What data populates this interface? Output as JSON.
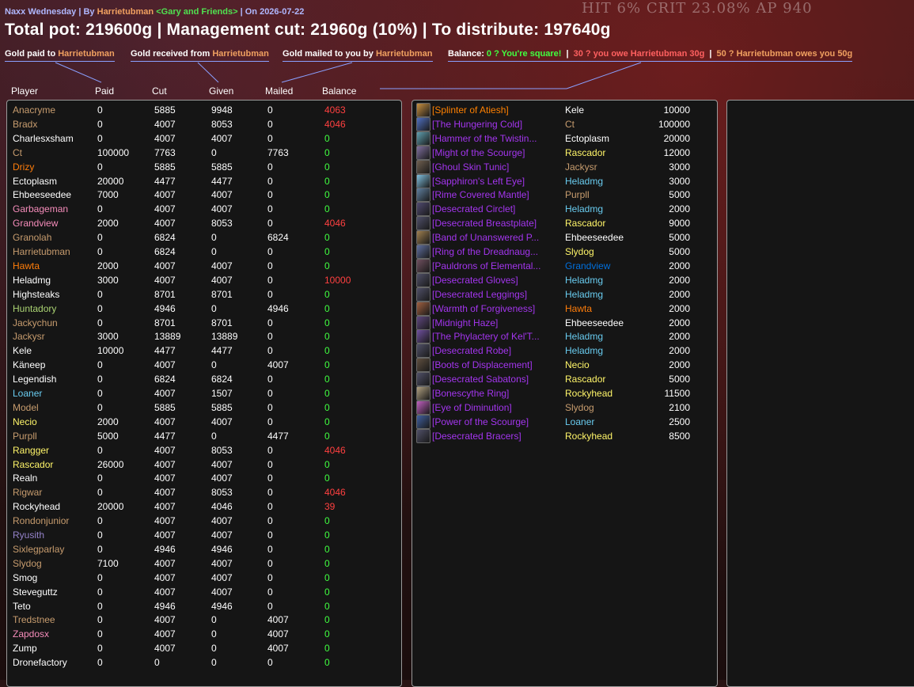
{
  "header": {
    "raid_name": "Naxx Wednesday",
    "by_prefix": "| By",
    "author": "Harrietubman",
    "guild": "<Gary and Friends>",
    "date_text": "| On 2026-07-22"
  },
  "title": "Total pot: 219600g | Management cut: 21960g (10%) | To distribute: 197640g",
  "background_text": "HIT 6% CRIT 23.08% AP 940",
  "legend": {
    "paid_prefix": "Gold paid to",
    "received_prefix": "Gold received from",
    "mailed_prefix": "Gold mailed to you by",
    "name": "Harrietubman",
    "balance_label": "Balance:",
    "square": "0 ? You're square!",
    "you_owe": "30 ? you owe Harrietubman 30g",
    "owes_you": "50 ? Harrietubman owes you 50g"
  },
  "columns": {
    "player": "Player",
    "paid": "Paid",
    "cut": "Cut",
    "given": "Given",
    "mailed": "Mailed",
    "balance": "Balance"
  },
  "colors": {
    "druid": "#ff7d0a",
    "paladin": "#f58cba",
    "warrior": "#c79c6e",
    "mage": "#69ccf0",
    "rogue": "#fff569",
    "warlock": "#9482c9",
    "hunter": "#abd473",
    "priest": "#ffffff",
    "shaman": "#0070de",
    "epic": "#a335ee",
    "legendary": "#ff8000",
    "balance_zero": "#40ff40",
    "balance_owe": "#ff4040"
  },
  "players": [
    {
      "name": "Anacryme",
      "cls": "warrior",
      "paid": "0",
      "cut": "5885",
      "given": "9948",
      "mailed": "0",
      "balance": "4063"
    },
    {
      "name": "Bradx",
      "cls": "warrior",
      "paid": "0",
      "cut": "4007",
      "given": "8053",
      "mailed": "0",
      "balance": "4046"
    },
    {
      "name": "Charlesxsham",
      "cls": "priest",
      "paid": "0",
      "cut": "4007",
      "given": "4007",
      "mailed": "0",
      "balance": "0"
    },
    {
      "name": "Ct",
      "cls": "warrior",
      "paid": "100000",
      "cut": "7763",
      "given": "0",
      "mailed": "7763",
      "balance": "0"
    },
    {
      "name": "Drizy",
      "cls": "druid",
      "paid": "0",
      "cut": "5885",
      "given": "5885",
      "mailed": "0",
      "balance": "0"
    },
    {
      "name": "Ectoplasm",
      "cls": "priest",
      "paid": "20000",
      "cut": "4477",
      "given": "4477",
      "mailed": "0",
      "balance": "0"
    },
    {
      "name": "Ehbeeseedee",
      "cls": "priest",
      "paid": "7000",
      "cut": "4007",
      "given": "4007",
      "mailed": "0",
      "balance": "0"
    },
    {
      "name": "Garbageman",
      "cls": "paladin",
      "paid": "0",
      "cut": "4007",
      "given": "4007",
      "mailed": "0",
      "balance": "0"
    },
    {
      "name": "Grandview",
      "cls": "paladin",
      "paid": "2000",
      "cut": "4007",
      "given": "8053",
      "mailed": "0",
      "balance": "4046"
    },
    {
      "name": "Granolah",
      "cls": "warrior",
      "paid": "0",
      "cut": "6824",
      "given": "0",
      "mailed": "6824",
      "balance": "0"
    },
    {
      "name": "Harrietubman",
      "cls": "warrior",
      "paid": "0",
      "cut": "6824",
      "given": "0",
      "mailed": "0",
      "balance": "0"
    },
    {
      "name": "Hawta",
      "cls": "druid",
      "paid": "2000",
      "cut": "4007",
      "given": "4007",
      "mailed": "0",
      "balance": "0"
    },
    {
      "name": "Heladmg",
      "cls": "priest",
      "paid": "3000",
      "cut": "4007",
      "given": "4007",
      "mailed": "0",
      "balance": "10000"
    },
    {
      "name": "Highsteaks",
      "cls": "priest",
      "paid": "0",
      "cut": "8701",
      "given": "8701",
      "mailed": "0",
      "balance": "0"
    },
    {
      "name": "Huntadory",
      "cls": "hunter",
      "paid": "0",
      "cut": "4946",
      "given": "0",
      "mailed": "4946",
      "balance": "0"
    },
    {
      "name": "Jackychun",
      "cls": "warrior",
      "paid": "0",
      "cut": "8701",
      "given": "8701",
      "mailed": "0",
      "balance": "0"
    },
    {
      "name": "Jackysr",
      "cls": "warrior",
      "paid": "3000",
      "cut": "13889",
      "given": "13889",
      "mailed": "0",
      "balance": "0"
    },
    {
      "name": "Kele",
      "cls": "priest",
      "paid": "10000",
      "cut": "4477",
      "given": "4477",
      "mailed": "0",
      "balance": "0"
    },
    {
      "name": "Käneep",
      "cls": "priest",
      "paid": "0",
      "cut": "4007",
      "given": "0",
      "mailed": "4007",
      "balance": "0"
    },
    {
      "name": "Legendish",
      "cls": "priest",
      "paid": "0",
      "cut": "6824",
      "given": "6824",
      "mailed": "0",
      "balance": "0"
    },
    {
      "name": "Loaner",
      "cls": "mage",
      "paid": "0",
      "cut": "4007",
      "given": "1507",
      "mailed": "0",
      "balance": "0"
    },
    {
      "name": "Model",
      "cls": "warrior",
      "paid": "0",
      "cut": "5885",
      "given": "5885",
      "mailed": "0",
      "balance": "0"
    },
    {
      "name": "Necio",
      "cls": "rogue",
      "paid": "2000",
      "cut": "4007",
      "given": "4007",
      "mailed": "0",
      "balance": "0"
    },
    {
      "name": "Purpll",
      "cls": "warrior",
      "paid": "5000",
      "cut": "4477",
      "given": "0",
      "mailed": "4477",
      "balance": "0"
    },
    {
      "name": "Rangger",
      "cls": "rogue",
      "paid": "0",
      "cut": "4007",
      "given": "8053",
      "mailed": "0",
      "balance": "4046"
    },
    {
      "name": "Rascador",
      "cls": "rogue",
      "paid": "26000",
      "cut": "4007",
      "given": "4007",
      "mailed": "0",
      "balance": "0"
    },
    {
      "name": "Realn",
      "cls": "priest",
      "paid": "0",
      "cut": "4007",
      "given": "4007",
      "mailed": "0",
      "balance": "0"
    },
    {
      "name": "Rigwar",
      "cls": "warrior",
      "paid": "0",
      "cut": "4007",
      "given": "8053",
      "mailed": "0",
      "balance": "4046"
    },
    {
      "name": "Rockyhead",
      "cls": "priest",
      "paid": "20000",
      "cut": "4007",
      "given": "4046",
      "mailed": "0",
      "balance": "39"
    },
    {
      "name": "Rondonjunior",
      "cls": "warrior",
      "paid": "0",
      "cut": "4007",
      "given": "4007",
      "mailed": "0",
      "balance": "0"
    },
    {
      "name": "Ryusith",
      "cls": "warlock",
      "paid": "0",
      "cut": "4007",
      "given": "4007",
      "mailed": "0",
      "balance": "0"
    },
    {
      "name": "Sixlegparlay",
      "cls": "warrior",
      "paid": "0",
      "cut": "4946",
      "given": "4946",
      "mailed": "0",
      "balance": "0"
    },
    {
      "name": "Slydog",
      "cls": "warrior",
      "paid": "7100",
      "cut": "4007",
      "given": "4007",
      "mailed": "0",
      "balance": "0"
    },
    {
      "name": "Smog",
      "cls": "priest",
      "paid": "0",
      "cut": "4007",
      "given": "4007",
      "mailed": "0",
      "balance": "0"
    },
    {
      "name": "Steveguttz",
      "cls": "priest",
      "paid": "0",
      "cut": "4007",
      "given": "4007",
      "mailed": "0",
      "balance": "0"
    },
    {
      "name": "Teto",
      "cls": "priest",
      "paid": "0",
      "cut": "4946",
      "given": "4946",
      "mailed": "0",
      "balance": "0"
    },
    {
      "name": "Tredstnee",
      "cls": "warrior",
      "paid": "0",
      "cut": "4007",
      "given": "0",
      "mailed": "4007",
      "balance": "0"
    },
    {
      "name": "Zapdosx",
      "cls": "paladin",
      "paid": "0",
      "cut": "4007",
      "given": "0",
      "mailed": "4007",
      "balance": "0"
    },
    {
      "name": "Zump",
      "cls": "priest",
      "paid": "0",
      "cut": "4007",
      "given": "0",
      "mailed": "4007",
      "balance": "0"
    },
    {
      "name": "Dronefactory",
      "cls": "priest",
      "paid": "0",
      "cut": "0",
      "given": "0",
      "mailed": "0",
      "balance": "0"
    }
  ],
  "loot": [
    {
      "item": "[Splinter of Atiesh]",
      "rarity": "legendary",
      "icon": "splinter-icon",
      "icon_color": "#c89040",
      "winner": "Kele",
      "wcls": "priest",
      "price": "10000"
    },
    {
      "item": "[The Hungering Cold]",
      "rarity": "epic",
      "icon": "frost-rune-icon",
      "icon_color": "#5070c0",
      "winner": "Ct",
      "wcls": "warrior",
      "price": "100000"
    },
    {
      "item": "[Hammer of the Twistin...",
      "rarity": "epic",
      "icon": "hammer-icon",
      "icon_color": "#60a0b0",
      "winner": "Ectoplasm",
      "wcls": "priest",
      "price": "20000"
    },
    {
      "item": "[Might of the Scourge]",
      "rarity": "epic",
      "icon": "shoulder-icon",
      "icon_color": "#8070a0",
      "winner": "Rascador",
      "wcls": "rogue",
      "price": "12000"
    },
    {
      "item": "[Ghoul Skin Tunic]",
      "rarity": "epic",
      "icon": "tunic-icon",
      "icon_color": "#706050",
      "winner": "Jackysr",
      "wcls": "warrior",
      "price": "3000"
    },
    {
      "item": "[Sapphiron's Left Eye]",
      "rarity": "epic",
      "icon": "eye-gem-icon",
      "icon_color": "#80c0e0",
      "winner": "Heladmg",
      "wcls": "mage",
      "price": "3000"
    },
    {
      "item": "[Rime Covered Mantle]",
      "rarity": "epic",
      "icon": "mantle-icon",
      "icon_color": "#6080a0",
      "winner": "Purpll",
      "wcls": "warrior",
      "price": "5000"
    },
    {
      "item": "[Desecrated Circlet]",
      "rarity": "epic",
      "icon": "circlet-icon",
      "icon_color": "#504a70",
      "winner": "Heladmg",
      "wcls": "mage",
      "price": "2000"
    },
    {
      "item": "[Desecrated Breastplate]",
      "rarity": "epic",
      "icon": "breastplate-icon",
      "icon_color": "#50506a",
      "winner": "Rascador",
      "wcls": "rogue",
      "price": "9000"
    },
    {
      "item": "[Band of Unanswered P...",
      "rarity": "epic",
      "icon": "ring-icon",
      "icon_color": "#a08050",
      "winner": "Ehbeeseedee",
      "wcls": "priest",
      "price": "5000"
    },
    {
      "item": "[Ring of the Dreadnaug...",
      "rarity": "epic",
      "icon": "ring-icon",
      "icon_color": "#6070a0",
      "winner": "Slydog",
      "wcls": "rogue",
      "price": "5000"
    },
    {
      "item": "[Pauldrons of Elemental...",
      "rarity": "epic",
      "icon": "pauldron-icon",
      "icon_color": "#705060",
      "winner": "Grandview",
      "wcls": "shaman",
      "price": "2000"
    },
    {
      "item": "[Desecrated Gloves]",
      "rarity": "epic",
      "icon": "gloves-icon",
      "icon_color": "#505068",
      "winner": "Heladmg",
      "wcls": "mage",
      "price": "2000"
    },
    {
      "item": "[Desecrated Leggings]",
      "rarity": "epic",
      "icon": "leggings-icon",
      "icon_color": "#505068",
      "winner": "Heladmg",
      "wcls": "mage",
      "price": "2000"
    },
    {
      "item": "[Warmth of Forgiveness]",
      "rarity": "epic",
      "icon": "trinket-icon",
      "icon_color": "#a06040",
      "winner": "Hawta",
      "wcls": "druid",
      "price": "2000"
    },
    {
      "item": "[Midnight Haze]",
      "rarity": "epic",
      "icon": "dagger-icon",
      "icon_color": "#604880",
      "winner": "Ehbeeseedee",
      "wcls": "priest",
      "price": "2000"
    },
    {
      "item": "[The Phylactery of Kel'T...",
      "rarity": "epic",
      "icon": "phylactery-icon",
      "icon_color": "#7050a0",
      "winner": "Heladmg",
      "wcls": "mage",
      "price": "2000"
    },
    {
      "item": "[Desecrated Robe]",
      "rarity": "epic",
      "icon": "robe-icon",
      "icon_color": "#505068",
      "winner": "Heladmg",
      "wcls": "mage",
      "price": "2000"
    },
    {
      "item": "[Boots of Displacement]",
      "rarity": "epic",
      "icon": "boots-icon",
      "icon_color": "#605040",
      "winner": "Necio",
      "wcls": "rogue",
      "price": "2000"
    },
    {
      "item": "[Desecrated Sabatons]",
      "rarity": "epic",
      "icon": "sabatons-icon",
      "icon_color": "#505068",
      "winner": "Rascador",
      "wcls": "rogue",
      "price": "5000"
    },
    {
      "item": "[Bonescythe Ring]",
      "rarity": "epic",
      "icon": "ring-icon",
      "icon_color": "#b0a080",
      "winner": "Rockyhead",
      "wcls": "rogue",
      "price": "11500"
    },
    {
      "item": "[Eye of Diminution]",
      "rarity": "epic",
      "icon": "eye-icon",
      "icon_color": "#c060c0",
      "winner": "Slydog",
      "wcls": "warrior",
      "price": "2100"
    },
    {
      "item": "[Power of the Scourge]",
      "rarity": "epic",
      "icon": "shoulder-icon",
      "icon_color": "#4060a0",
      "winner": "Loaner",
      "wcls": "mage",
      "price": "2500"
    },
    {
      "item": "[Desecrated Bracers]",
      "rarity": "epic",
      "icon": "bracers-icon",
      "icon_color": "#505068",
      "winner": "Rockyhead",
      "wcls": "rogue",
      "price": "8500"
    }
  ]
}
